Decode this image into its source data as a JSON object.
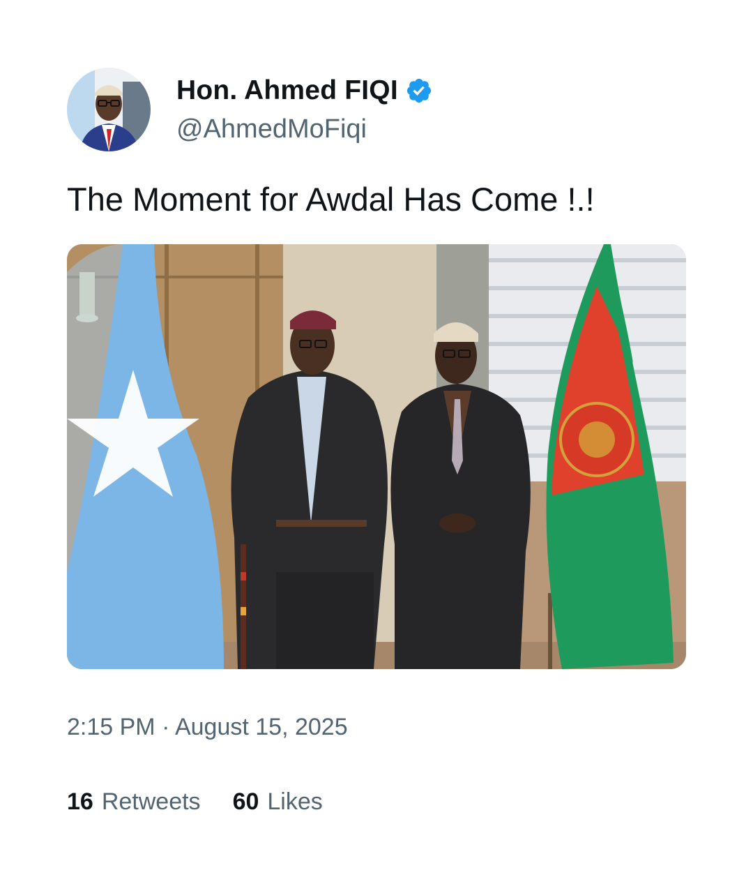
{
  "author": {
    "display_name": "Hon. Ahmed FIQI",
    "handle": "@AhmedMoFiqi",
    "verified": true,
    "verified_color": "#1d9bf0",
    "avatar_icon": "profile-photo"
  },
  "tweet": {
    "text": "The Moment for Awdal Has Come !.!",
    "image_icon": "photo-two-men-with-flags",
    "timestamp": "2:15 PM · August 15, 2025"
  },
  "stats": {
    "retweets_count": "16",
    "retweets_label": "Retweets",
    "likes_count": "60",
    "likes_label": "Likes"
  },
  "colors": {
    "text_primary": "#0f1419",
    "text_secondary": "#536471",
    "somali_flag_blue": "#7bb6e6",
    "awdal_red": "#e0412c",
    "awdal_green": "#1e9a5c"
  }
}
